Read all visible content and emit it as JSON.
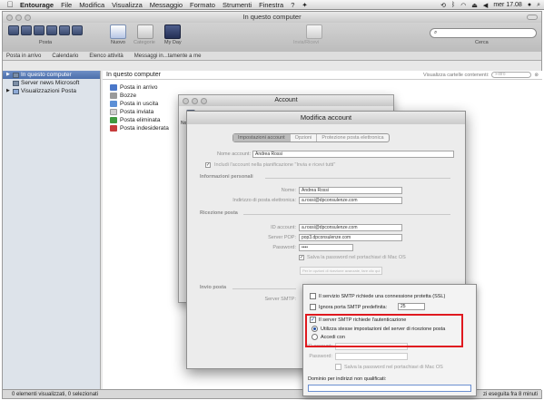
{
  "menubar": {
    "apple": "",
    "app": "Entourage",
    "items": [
      "File",
      "Modifica",
      "Visualizza",
      "Messaggio",
      "Formato",
      "Strumenti",
      "Finestra",
      "?",
      "✦"
    ],
    "clock": "mer 17.08"
  },
  "main": {
    "title": "In questo computer",
    "toolbar": {
      "labels": [
        "Posta",
        "Nuovo",
        "Categorie",
        "My Day",
        "Invia/Ricevi",
        "Cerca"
      ]
    },
    "tabs": [
      "Posta in arrivo",
      "Calendario",
      "Elenco attività",
      "Messaggi in...tamente a me"
    ],
    "sidebar": [
      {
        "label": "In questo computer"
      },
      {
        "label": "Server news Microsoft"
      },
      {
        "label": "Visualizzazioni Posta"
      }
    ],
    "content_title": "In questo computer",
    "show_folders_label": "Visualizza cartelle contenenti:",
    "filter_placeholder": "Filtro",
    "folders": [
      {
        "label": "Posta in arrivo",
        "color": "#4a77c9"
      },
      {
        "label": "Bozze",
        "color": "#9a9a9a"
      },
      {
        "label": "Posta in uscita",
        "color": "#5b8fd6"
      },
      {
        "label": "Posta inviata",
        "color": "#d0d0d0"
      },
      {
        "label": "Posta eliminata",
        "color": "#3f9a3f"
      },
      {
        "label": "Posta indesiderata",
        "color": "#c63c3c"
      }
    ],
    "status_left": "0 elementi visualizzati, 0 selezionati",
    "status_right": "zi eseguita fra 8 minuti"
  },
  "account_window": {
    "title": "Account",
    "col_label": "Nome"
  },
  "modifica": {
    "title": "Modifica account",
    "tabs": [
      "Impostazioni account",
      "Opzioni",
      "Protezione posta elettronica"
    ],
    "nome_account_label": "Nome account:",
    "nome_account_value": "Andrea Rossi",
    "includi_label": "Includi l'account nella pianificazione \"Invia e ricevi tutti\"",
    "info_personali": "Informazioni personali",
    "nome_label": "Nome:",
    "nome_value": "Andrea Rossi",
    "email_label": "Indirizzo di posta elettronica:",
    "email_value": "a.rossi@dpconsulenze.com",
    "ricezione": "Ricezione posta",
    "id_account_label": "ID account:",
    "id_account_value": "a.rossi@dpconsulenze.com",
    "server_pop_label": "Server POP:",
    "server_pop_value": "pop3.dpconsulenze.com",
    "password_label": "Password:",
    "password_value": "••••",
    "salva_pw": "Salva la password nel portachiavi di Mac OS",
    "opzioni_ricez": "Per le opzioni di ricezione avanzate, fare clic qui",
    "invio": "Invio posta",
    "server_smtp_label": "Server SMTP:"
  },
  "smtp_popup": {
    "ssl": "Il servizio SMTP richiede una connessione protetta (SSL)",
    "ignora_porta": "Ignora porta SMTP predefinita:",
    "porta_value": "25",
    "richiede_auth": "Il server SMTP richiede l'autenticazione",
    "usa_stesse": "Utilizza stesse impostazioni del server di ricezione posta",
    "accedi_con": "Accedi con",
    "id_account": "ID account:",
    "password": "Password:",
    "salva_pw": "Salva la password nel portachiavi di Mac OS",
    "dominio": "Dominio per indirizzi non qualificati:"
  },
  "colors": {
    "highlight": "#e0191f",
    "selection": "#4b6eaa"
  }
}
